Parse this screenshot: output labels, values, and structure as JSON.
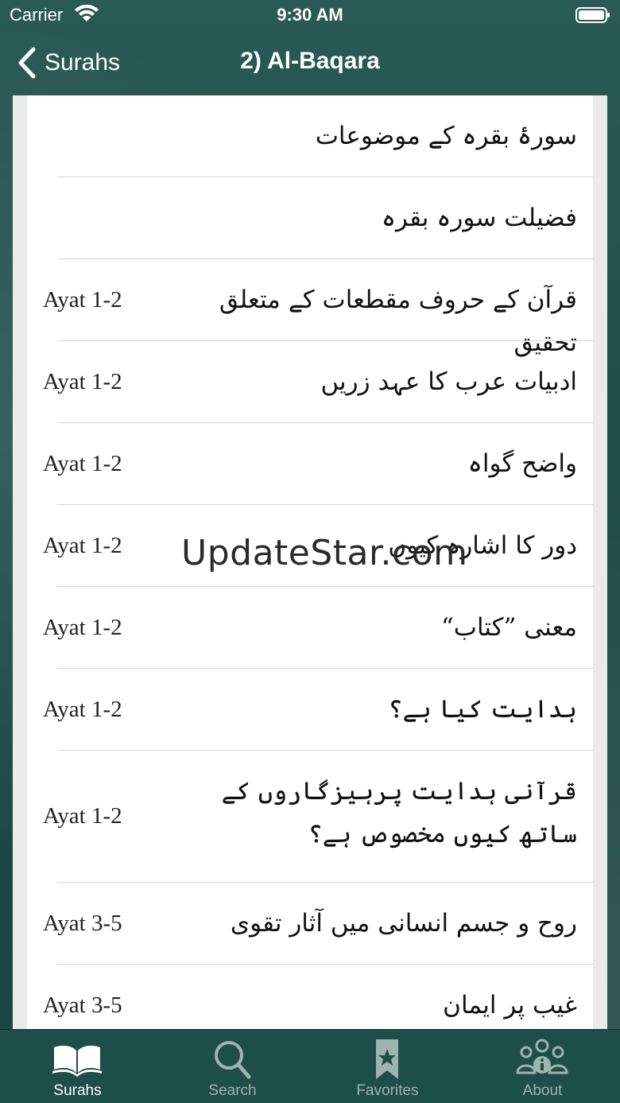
{
  "status": {
    "carrier": "Carrier",
    "time": "9:30 AM"
  },
  "nav": {
    "back_label": "Surahs",
    "title": "2) Al-Baqara"
  },
  "rows": [
    {
      "title": "سورۂ بقرہ کے موضوعات",
      "ayat": ""
    },
    {
      "title": "فضیلت سورہ بقرہ",
      "ayat": ""
    },
    {
      "title": "قرآن کے حروف مقطعات کے متعلق تحقیق",
      "ayat": "Ayat 1-2"
    },
    {
      "title": "ادبیات عرب کا عہد زریں",
      "ayat": "Ayat 1-2"
    },
    {
      "title": "واضح گواہ",
      "ayat": "Ayat 1-2"
    },
    {
      "title": "دور کا اشارہ کیوں",
      "ayat": "Ayat 1-2"
    },
    {
      "title": "معنی ”کتاب“",
      "ayat": "Ayat 1-2"
    },
    {
      "title": "ہدایت کیا ہے؟",
      "ayat": "Ayat 1-2"
    },
    {
      "title": "قرآنی ہدایت پرہیزگاروں کے ساتھ کیوں مخصوص ہے؟",
      "ayat": "Ayat 1-2"
    },
    {
      "title": "روح و جسم انسانی میں آثار تقوی",
      "ayat": "Ayat 3-5"
    },
    {
      "title": "غیب پر ایمان",
      "ayat": "Ayat 3-5"
    }
  ],
  "watermark": "UpdateStar.com",
  "tabs": [
    {
      "label": "Surahs",
      "icon": "open-book-icon",
      "active": true
    },
    {
      "label": "Search",
      "icon": "search-icon",
      "active": false
    },
    {
      "label": "Favorites",
      "icon": "bookmark-star-icon",
      "active": false
    },
    {
      "label": "About",
      "icon": "people-info-icon",
      "active": false
    }
  ],
  "colors": {
    "bar": "#1e4e49",
    "tab_active": "#ffffff",
    "tab_inactive": "#9fb3b0"
  }
}
